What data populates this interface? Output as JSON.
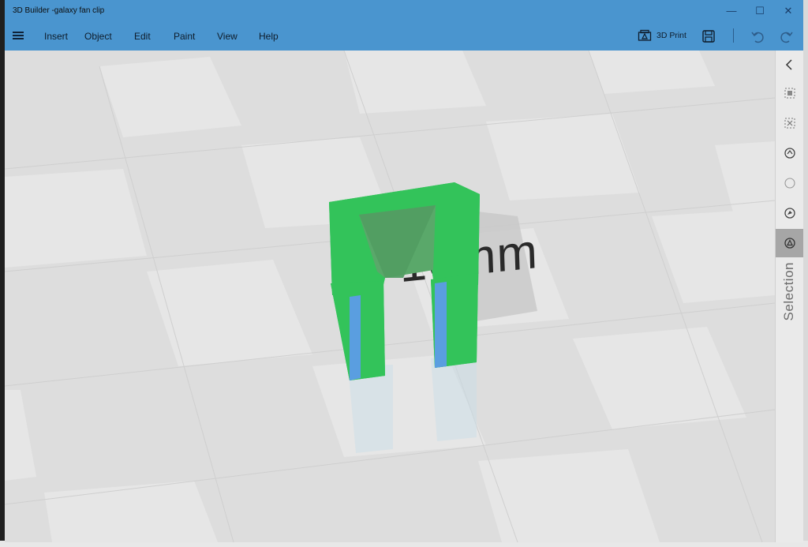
{
  "window": {
    "title": "3D Builder -galaxy fan clip",
    "minimize": "—",
    "maximize": "☐",
    "close": "✕"
  },
  "menu": {
    "items": [
      "Insert",
      "Object",
      "Edit",
      "Paint",
      "View",
      "Help"
    ]
  },
  "toolbar": {
    "print_label": "3D Print",
    "print_icon": "3d-print-icon",
    "save_icon": "save-icon",
    "undo_icon": "undo-icon",
    "redo_icon": "redo-icon"
  },
  "viewport": {
    "text_object": "10mm",
    "object_color": "#33c35a",
    "object_side_color": "#5a9ee0"
  },
  "rail": {
    "label": "Selection",
    "icons": [
      "chevron-left-icon",
      "select-all-icon",
      "deselect-icon",
      "select-object-icon",
      "select-circle-icon",
      "select-face-icon",
      "select-triangle-icon"
    ]
  }
}
